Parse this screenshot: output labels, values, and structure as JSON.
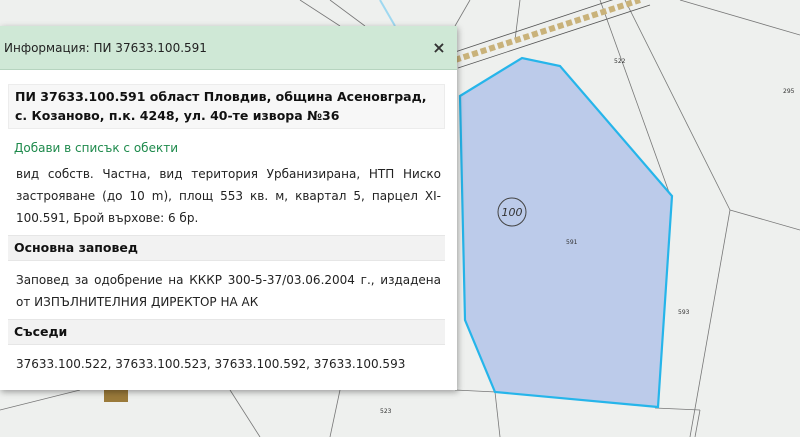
{
  "map": {
    "zone_label": "100",
    "parcel_labels": [
      "522",
      "295",
      "591",
      "593",
      "523"
    ]
  },
  "colors": {
    "parcel_fill": "#bccbea",
    "parcel_stroke": "#26b5ea",
    "header_bg": "#cfe8d6",
    "link": "#1e8a4c"
  },
  "panel": {
    "title": "Информация: ПИ 37633.100.591",
    "close_label": "×",
    "heading": "ПИ 37633.100.591 област Пловдив, община Асеновград, с. Козаново, п.к. 4248, ул. 40-те извора №36",
    "add_link": "Добави в списък с обекти",
    "description": "вид собств. Частна, вид територия Урбанизирана, НТП Ниско застрояване (до 10 m), площ 553 кв. м, квартал 5, парцел XI-100.591, Брой върхове: 6 бр.",
    "order_title": "Основна заповед",
    "order_text": "Заповед за одобрение на КККР 300-5-37/03.06.2004 г., издадена от ИЗПЪЛНИТЕЛНИЯ ДИРЕКТОР НА АК",
    "neighbors_title": "Съседи",
    "neighbors_text": "37633.100.522, 37633.100.523, 37633.100.592, 37633.100.593"
  }
}
